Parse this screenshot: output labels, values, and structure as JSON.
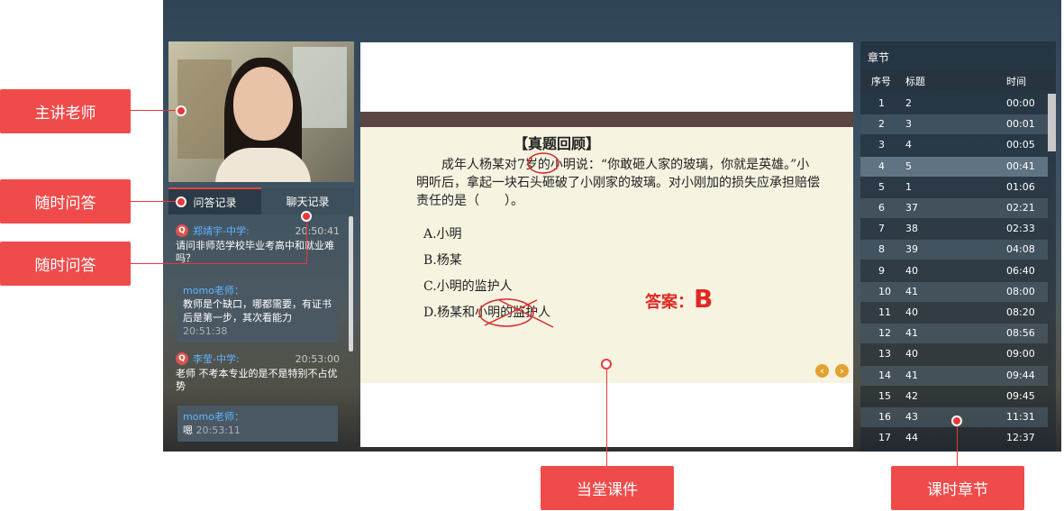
{
  "video": {
    "name": "teacher-video"
  },
  "left_tabs": {
    "qa": "问答记录",
    "chat": "聊天记录"
  },
  "qa": [
    {
      "name": "郑靖宇-中学:",
      "time": "20:50:41",
      "text": "请问非师范学校毕业考高中和就业难吗？",
      "reply": {
        "name": "momo老师：",
        "text": "教师是个缺口，哪都需要，有证书后是第一步，其次看能力",
        "time": "20:51:38"
      }
    },
    {
      "name": "李莹-中学:",
      "time": "20:53:00",
      "text": "老师 不考本专业的是不是特别不占优势",
      "reply": {
        "name": "momo老师：",
        "text": "嗯",
        "time": "20:53:11"
      }
    }
  ],
  "slide": {
    "title": "【真题回顾】",
    "question": "成年人杨某对7岁的小明说：“你敢砸人家的玻璃，你就是英雄。”小明听后，拿起一块石头砸破了小刚家的玻璃。对小刚加的损失应承担赔偿责任的是（　　）。",
    "options": [
      "A.小明",
      "B.杨某",
      "C.小明的监护人",
      "D.杨某和小明的监护人"
    ],
    "answer_label": "答案：",
    "answer_value": "B"
  },
  "chapters": {
    "title": "章节",
    "headers": {
      "index": "序号",
      "title": "标题",
      "time": "时间"
    },
    "rows": [
      [
        "1",
        "2",
        "00:00"
      ],
      [
        "2",
        "3",
        "00:01"
      ],
      [
        "3",
        "4",
        "00:05"
      ],
      [
        "4",
        "5",
        "00:41"
      ],
      [
        "5",
        "1",
        "01:06"
      ],
      [
        "6",
        "37",
        "02:21"
      ],
      [
        "7",
        "38",
        "02:33"
      ],
      [
        "8",
        "39",
        "04:08"
      ],
      [
        "9",
        "40",
        "06:40"
      ],
      [
        "10",
        "41",
        "08:00"
      ],
      [
        "11",
        "40",
        "08:20"
      ],
      [
        "12",
        "41",
        "08:56"
      ],
      [
        "13",
        "40",
        "09:00"
      ],
      [
        "14",
        "41",
        "09:44"
      ],
      [
        "15",
        "42",
        "09:45"
      ],
      [
        "16",
        "43",
        "11:31"
      ],
      [
        "17",
        "44",
        "12:37"
      ]
    ]
  },
  "callouts": {
    "teacher": "主讲老师",
    "qa1": "随时问答",
    "qa2": "随时问答",
    "courseware": "当堂课件",
    "chapters": "课时章节"
  },
  "colors": {
    "accent": "#f04b4b",
    "answer": "#e12822",
    "name_blue": "#5fb5ff"
  }
}
